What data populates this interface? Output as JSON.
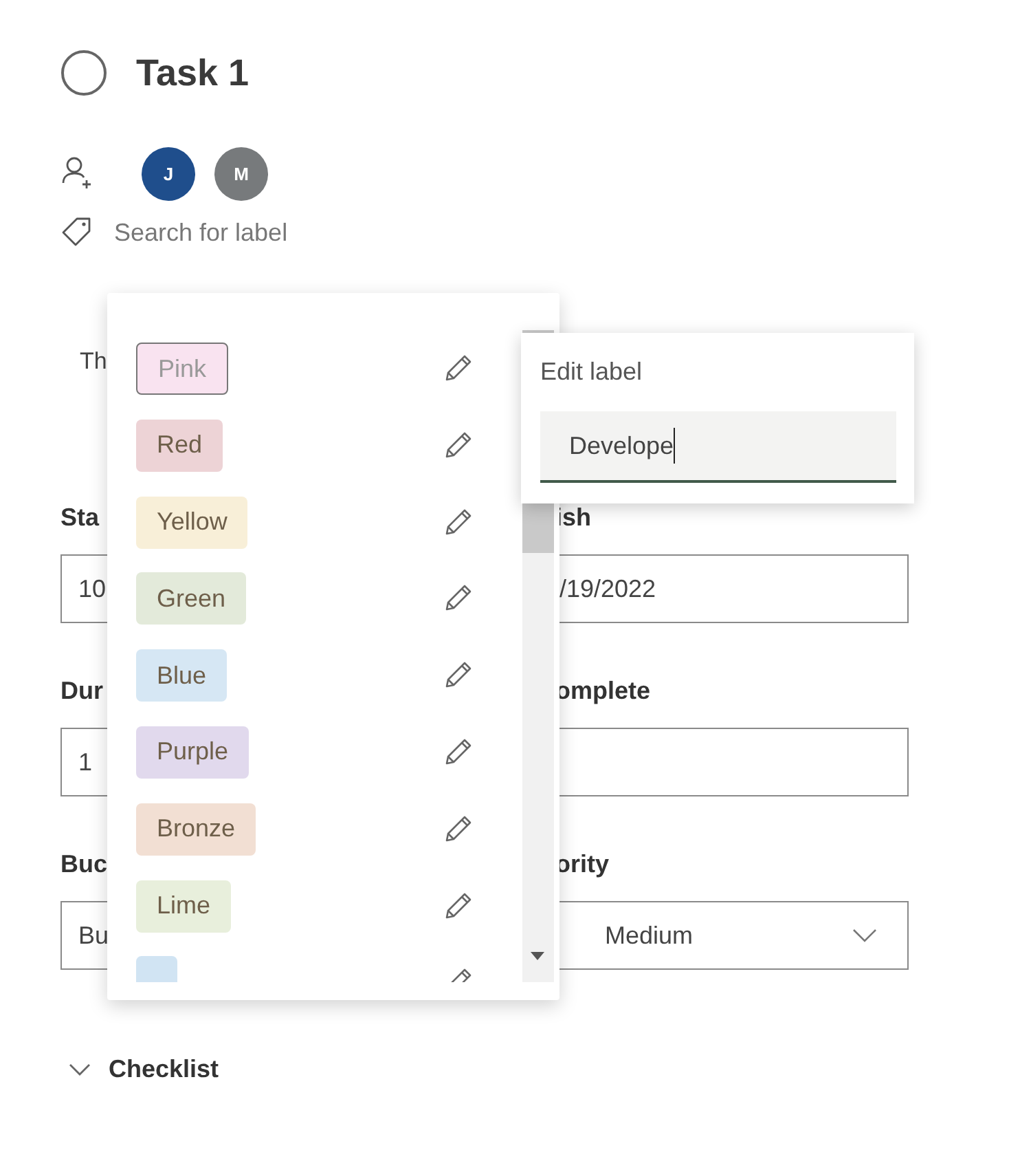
{
  "task": {
    "title": "Task 1",
    "completed": false
  },
  "assignees": [
    {
      "initials": "J",
      "color": "#1f4e8c"
    },
    {
      "initials": "M",
      "color": "#777a7c"
    }
  ],
  "label_search": {
    "placeholder": "Search for label"
  },
  "notes_fragment": "Th",
  "form_left": [
    {
      "label": "Sta",
      "value": "10"
    },
    {
      "label": "Dur",
      "value": "1"
    },
    {
      "label": "Buc",
      "value": "Bu"
    }
  ],
  "form_right": [
    {
      "label": "ish",
      "value": "/19/2022",
      "kind": "text"
    },
    {
      "label": "omplete",
      "kind": "text"
    },
    {
      "label": "ority",
      "value": "Medium",
      "kind": "dropdown"
    }
  ],
  "checklist": {
    "label": "Checklist",
    "expanded": true
  },
  "label_menu": {
    "items": [
      {
        "name": "Pink",
        "color": "#f9e3f0",
        "selected": true
      },
      {
        "name": "Red",
        "color": "#edd3d6",
        "selected": false
      },
      {
        "name": "Yellow",
        "color": "#f8efd8",
        "selected": false
      },
      {
        "name": "Green",
        "color": "#e3eada",
        "selected": false
      },
      {
        "name": "Blue",
        "color": "#d6e7f4",
        "selected": false
      },
      {
        "name": "Purple",
        "color": "#e1d9ed",
        "selected": false
      },
      {
        "name": "Bronze",
        "color": "#f2dfd3",
        "selected": false
      },
      {
        "name": "Lime",
        "color": "#e8efdc",
        "selected": false
      },
      {
        "color": "#d1e4f3",
        "selected": false
      }
    ]
  },
  "edit_label": {
    "title": "Edit label",
    "value": "Develope"
  }
}
